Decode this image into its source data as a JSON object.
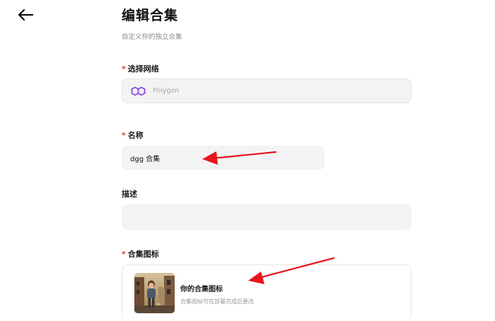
{
  "header": {
    "title": "编辑合集",
    "subtitle": "自定义你的独立合集",
    "back_icon": "arrow-left-icon"
  },
  "form": {
    "required_mark": "*",
    "network": {
      "label": "选择网络",
      "value": "Polygon",
      "icon": "polygon-icon",
      "icon_color": "#8247e5"
    },
    "name": {
      "label": "名称",
      "value": "dgg 合集"
    },
    "description": {
      "label": "描述",
      "value": ""
    },
    "collection_icon": {
      "label": "合集图标",
      "title": "你的合集图标",
      "hint": "合集图标可在部署完成后更改"
    }
  },
  "annotations": {
    "arrow_color": "#e8141c"
  }
}
